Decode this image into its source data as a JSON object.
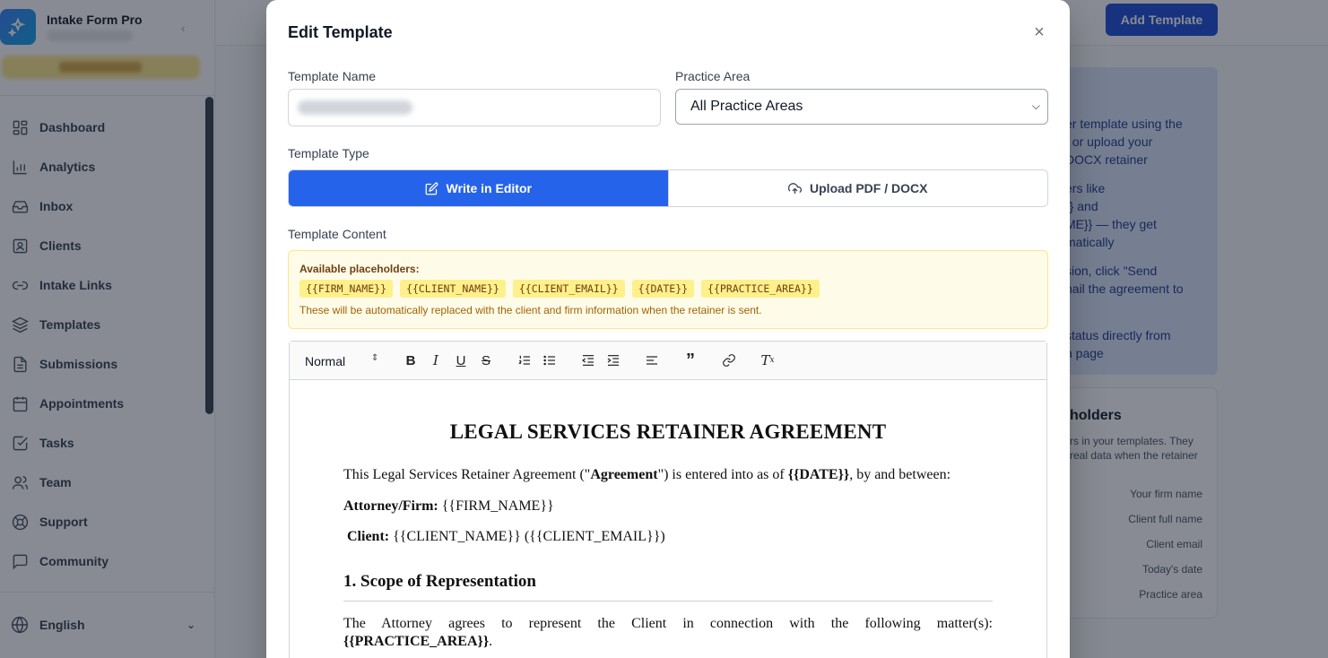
{
  "app": {
    "name": "Intake Form Pro"
  },
  "sidebar": {
    "items": [
      {
        "label": "Dashboard",
        "icon": "grid-icon"
      },
      {
        "label": "Analytics",
        "icon": "bar-chart-icon"
      },
      {
        "label": "Inbox",
        "icon": "inbox-icon"
      },
      {
        "label": "Clients",
        "icon": "contact-card-icon"
      },
      {
        "label": "Intake Links",
        "icon": "link-icon"
      },
      {
        "label": "Templates",
        "icon": "layers-icon"
      },
      {
        "label": "Submissions",
        "icon": "document-icon"
      },
      {
        "label": "Appointments",
        "icon": "calendar-icon"
      },
      {
        "label": "Tasks",
        "icon": "checkbox-icon"
      },
      {
        "label": "Team",
        "icon": "users-icon"
      },
      {
        "label": "Support",
        "icon": "lifebuoy-icon"
      },
      {
        "label": "Community",
        "icon": "chat-icon"
      }
    ],
    "language": "English"
  },
  "header": {
    "add_template_label": "Add Template"
  },
  "background_info": {
    "lines": [
      "er template using the",
      ", or upload your",
      "DOCX retainer",
      "ers like",
      "}} and",
      "ME}} — they get",
      "matically",
      "sion, click \"Send",
      "nail the agreement to",
      "status directly from",
      "n page"
    ],
    "placeholders_title": "holders",
    "placeholders_desc_1": "rs in your templates. They",
    "placeholders_desc_2": "real data when the retainer",
    "placeholder_rows": [
      "Your firm name",
      "Client full name",
      "Client email",
      "Today's date",
      "Practice area"
    ]
  },
  "modal": {
    "title": "Edit Template",
    "template_name_label": "Template Name",
    "practice_area_label": "Practice Area",
    "practice_area_value": "All Practice Areas",
    "template_type_label": "Template Type",
    "type_write": "Write in Editor",
    "type_upload": "Upload PDF / DOCX",
    "content_label": "Template Content",
    "notice": {
      "title": "Available placeholders:",
      "chips": [
        "{{FIRM_NAME}}",
        "{{CLIENT_NAME}}",
        "{{CLIENT_EMAIL}}",
        "{{DATE}}",
        "{{PRACTICE_AREA}}"
      ],
      "footer": "These will be automatically replaced with the client and firm information when the retainer is sent."
    },
    "editor": {
      "format": "Normal",
      "doc_title": "LEGAL SERVICES RETAINER AGREEMENT",
      "intro_a": "This Legal Services Retainer Agreement (\"",
      "intro_b": "Agreement",
      "intro_c": "\") is entered into as of ",
      "intro_d": "{{DATE}}",
      "intro_e": ", by and between:",
      "firm_label": "Attorney/Firm:",
      "firm_value": " {{FIRM_NAME}}",
      "client_label": "Client:",
      "client_value": " {{CLIENT_NAME}} ({{CLIENT_EMAIL}})",
      "section1": "1. Scope of Representation",
      "scope_text": "The Attorney agrees to represent the Client in connection with the following matter(s):",
      "scope_value": "{{PRACTICE_AREA}}",
      "scope_end": "."
    }
  },
  "colors": {
    "primary": "#2563eb",
    "brand_button": "#1d4ed8",
    "notice_bg": "#fefce8",
    "chip_bg": "#fef08a"
  }
}
